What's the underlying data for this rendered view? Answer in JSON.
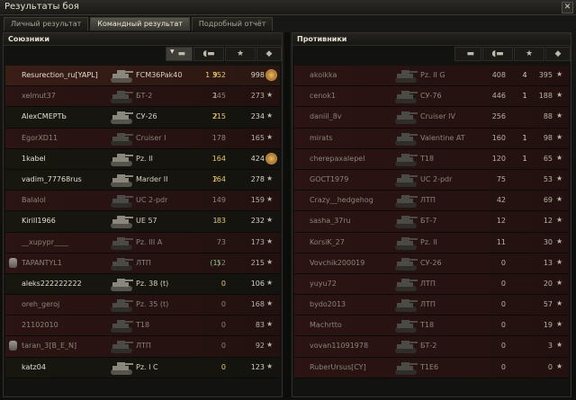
{
  "window": {
    "title": "Результаты боя",
    "close_glyph": "✕"
  },
  "tabs": [
    {
      "label": "Личный результат",
      "active": false
    },
    {
      "label": "Командный результат",
      "active": true
    },
    {
      "label": "Подробный отчёт",
      "active": false
    }
  ],
  "allies": {
    "title": "Союзники",
    "rows": [
      {
        "name": "Resurection_ru[YAPL]",
        "tank": "FCM36Pak40",
        "damage": "1 352",
        "kills": "9",
        "xp": "998",
        "state": "player",
        "dmg_hi": true,
        "kills_hi": true,
        "medal": true
      },
      {
        "name": "xelmut37",
        "tank": "БТ-2",
        "damage": "245",
        "kills": "1",
        "xp": "273",
        "state": "dead"
      },
      {
        "name": "AlexСМЕРТЬ",
        "tank": "СУ-26",
        "damage": "215",
        "kills": "2",
        "xp": "234",
        "state": "alive",
        "dmg_hi": true,
        "kills_hi": true
      },
      {
        "name": "EgorXD11",
        "tank": "Cruiser I",
        "damage": "178",
        "kills": "",
        "xp": "165",
        "state": "dead"
      },
      {
        "name": "1kabel",
        "tank": "Pz. II",
        "damage": "164",
        "kills": "",
        "xp": "424",
        "state": "alive",
        "dmg_hi": true,
        "medal": true
      },
      {
        "name": "vadim_77768rus",
        "tank": "Marder II",
        "damage": "164",
        "kills": "2",
        "xp": "278",
        "state": "alive",
        "dmg_hi": true,
        "kills_hi": true
      },
      {
        "name": "Balalol",
        "tank": "UC 2-pdr",
        "damage": "149",
        "kills": "",
        "xp": "159",
        "state": "dead"
      },
      {
        "name": "Kirill1966",
        "tank": "UE 57",
        "damage": "83",
        "kills": "1",
        "xp": "232",
        "state": "alive",
        "dmg_hi": true
      },
      {
        "name": "__xupypr____",
        "tank": "Pz. III A",
        "damage": "73",
        "kills": "",
        "xp": "173",
        "state": "dead"
      },
      {
        "name": "TAPANTYL1",
        "tank": "ЛТП",
        "damage": "52",
        "kills": "(1)",
        "xp": "215",
        "state": "dead",
        "chat": true,
        "paren": true
      },
      {
        "name": "aleks222222222",
        "tank": "Pz. 38 (t)",
        "damage": "0",
        "kills": "",
        "xp": "106",
        "state": "alive",
        "dmg_hi": true
      },
      {
        "name": "oreh_geroj",
        "tank": "Pz. 35 (t)",
        "damage": "0",
        "kills": "",
        "xp": "168",
        "state": "dead"
      },
      {
        "name": "21102010",
        "tank": "T18",
        "damage": "0",
        "kills": "",
        "xp": "83",
        "state": "dead"
      },
      {
        "name": "taran_3[B_E_N]",
        "tank": "ЛТП",
        "damage": "0",
        "kills": "",
        "xp": "92",
        "state": "dead",
        "chat": true
      },
      {
        "name": "katz04",
        "tank": "Pz. I C",
        "damage": "0",
        "kills": "",
        "xp": "123",
        "state": "alive",
        "dmg_hi": true
      }
    ]
  },
  "enemies": {
    "title": "Противники",
    "rows": [
      {
        "name": "akoikka",
        "tank": "Pz. II G",
        "damage": "408",
        "kills": "4",
        "xp": "395",
        "state": "dead"
      },
      {
        "name": "cenok1",
        "tank": "СУ-76",
        "damage": "446",
        "kills": "1",
        "xp": "188",
        "state": "dead"
      },
      {
        "name": "daniil_8v",
        "tank": "Cruiser IV",
        "damage": "256",
        "kills": "",
        "xp": "88",
        "state": "dead"
      },
      {
        "name": "mirats",
        "tank": "Valentine AT",
        "damage": "160",
        "kills": "1",
        "xp": "98",
        "state": "dead"
      },
      {
        "name": "cherepaxalepel",
        "tank": "T18",
        "damage": "120",
        "kills": "1",
        "xp": "65",
        "state": "dead"
      },
      {
        "name": "GOCT1979",
        "tank": "UC 2-pdr",
        "damage": "75",
        "kills": "",
        "xp": "53",
        "state": "dead"
      },
      {
        "name": "Crazy__hedgehog",
        "tank": "ЛТП",
        "damage": "42",
        "kills": "",
        "xp": "69",
        "state": "dead"
      },
      {
        "name": "sasha_37ru",
        "tank": "БТ-7",
        "damage": "12",
        "kills": "",
        "xp": "12",
        "state": "dead"
      },
      {
        "name": "KorsiK_27",
        "tank": "Pz. II",
        "damage": "11",
        "kills": "",
        "xp": "30",
        "state": "dead"
      },
      {
        "name": "Vovchik200019",
        "tank": "СУ-26",
        "damage": "0",
        "kills": "",
        "xp": "13",
        "state": "dead"
      },
      {
        "name": "yuyu72",
        "tank": "ЛТП",
        "damage": "0",
        "kills": "",
        "xp": "20",
        "state": "dead"
      },
      {
        "name": "bydo2013",
        "tank": "ЛТП",
        "damage": "0",
        "kills": "",
        "xp": "57",
        "state": "dead"
      },
      {
        "name": "Machrtto",
        "tank": "T18",
        "damage": "0",
        "kills": "",
        "xp": "19",
        "state": "dead"
      },
      {
        "name": "vovan11091978",
        "tank": "БТ-2",
        "damage": "0",
        "kills": "",
        "xp": "3",
        "state": "dead"
      },
      {
        "name": "RuberUrsus[CY]",
        "tank": "T1E6",
        "damage": "0",
        "kills": "",
        "xp": "0",
        "state": "dead"
      }
    ]
  },
  "column_icons": {
    "sort": "▼",
    "damage": "shell-icon",
    "kills": "tank-icon",
    "xp": "star-icon"
  },
  "colors": {
    "highlight": "#e8c866",
    "dead_row": "#2b1413",
    "player_row": "#3a1d16"
  }
}
